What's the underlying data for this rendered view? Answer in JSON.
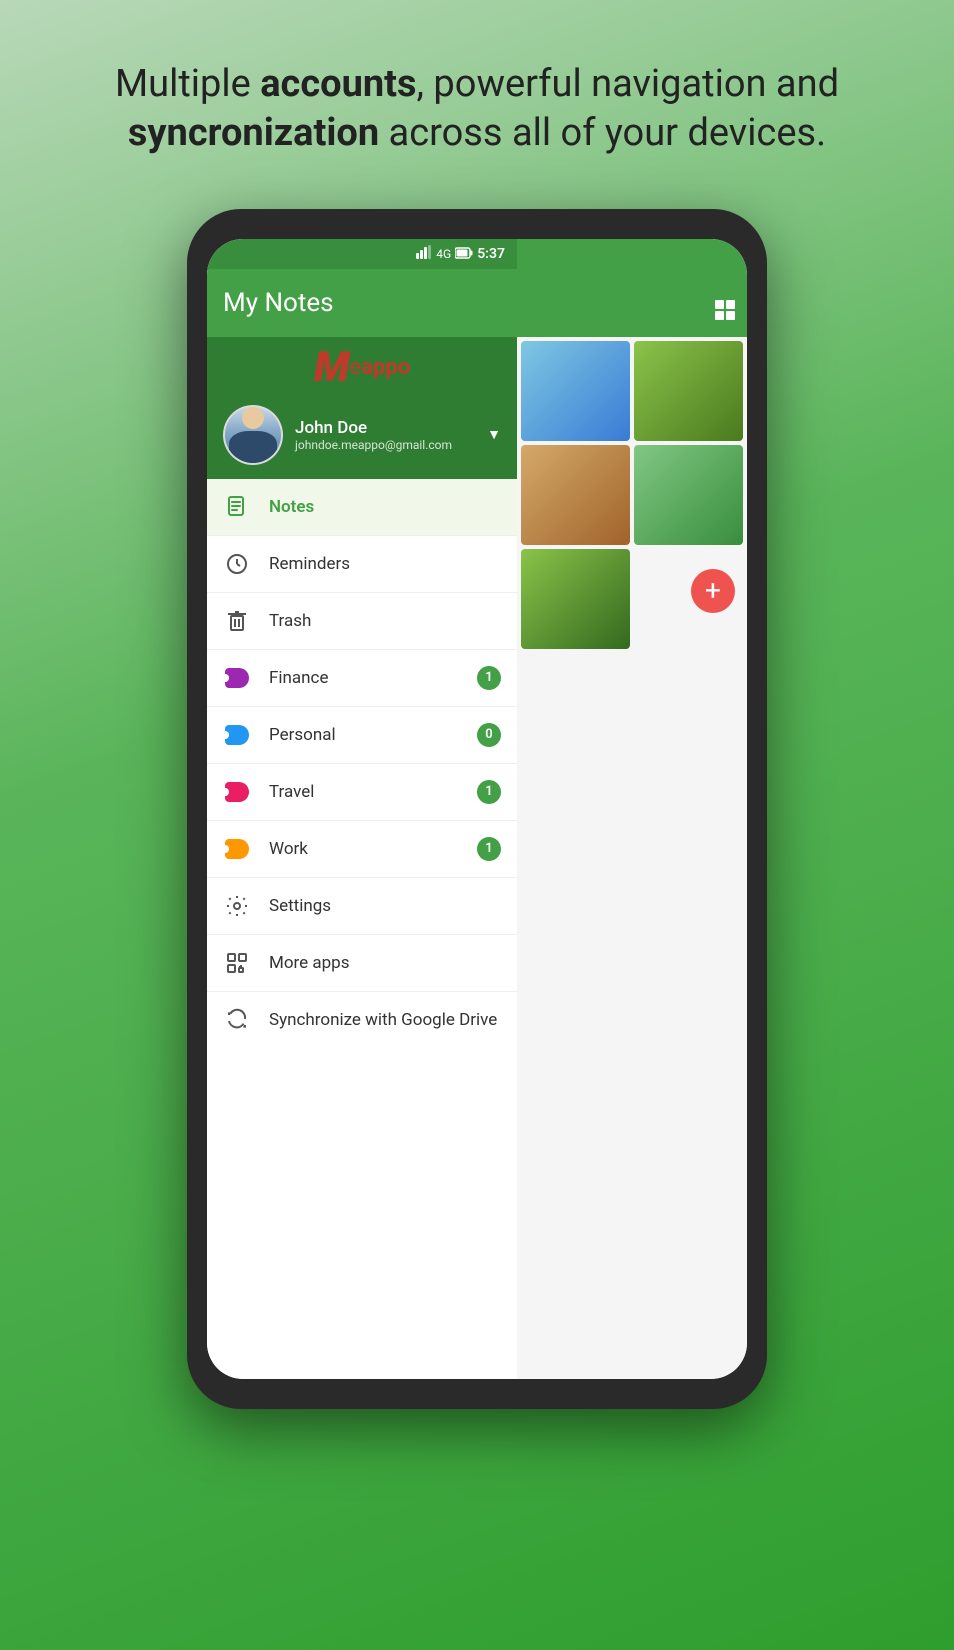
{
  "headline": {
    "part1": "Multiple ",
    "bold1": "accounts",
    "part2": ", powerful navigation and ",
    "bold2": "syncronization",
    "part3": " across all of your devices."
  },
  "status_bar": {
    "signal": "4G",
    "time": "5:37"
  },
  "app": {
    "title": "My Notes",
    "grid_icon": "⊞"
  },
  "user": {
    "name": "John Doe",
    "email": "johndoe.meappo@gmail.com"
  },
  "logo": {
    "m": "M",
    "text_normal": "e",
    "text_bold": "appo"
  },
  "nav_items": [
    {
      "id": "notes",
      "label": "Notes",
      "icon": "notes",
      "active": true,
      "badge": null
    },
    {
      "id": "reminders",
      "label": "Reminders",
      "icon": "reminders",
      "active": false,
      "badge": null
    },
    {
      "id": "trash",
      "label": "Trash",
      "icon": "trash",
      "active": false,
      "badge": null
    },
    {
      "id": "finance",
      "label": "Finance",
      "icon": "tag-purple",
      "active": false,
      "badge": "1",
      "color": "#9c27b0"
    },
    {
      "id": "personal",
      "label": "Personal",
      "icon": "tag-blue",
      "active": false,
      "badge": "0",
      "color": "#2196f3"
    },
    {
      "id": "travel",
      "label": "Travel",
      "icon": "tag-pink",
      "active": false,
      "badge": "1",
      "color": "#e91e63"
    },
    {
      "id": "work",
      "label": "Work",
      "icon": "tag-orange",
      "active": false,
      "badge": "1",
      "color": "#ff9800"
    }
  ],
  "bottom_items": [
    {
      "id": "settings",
      "label": "Settings",
      "icon": "settings"
    },
    {
      "id": "more-apps",
      "label": "More apps",
      "icon": "more-apps"
    }
  ],
  "sync": {
    "label": "Synchronize with Google Drive",
    "icon": "sync"
  },
  "fab": {
    "label": "+"
  }
}
